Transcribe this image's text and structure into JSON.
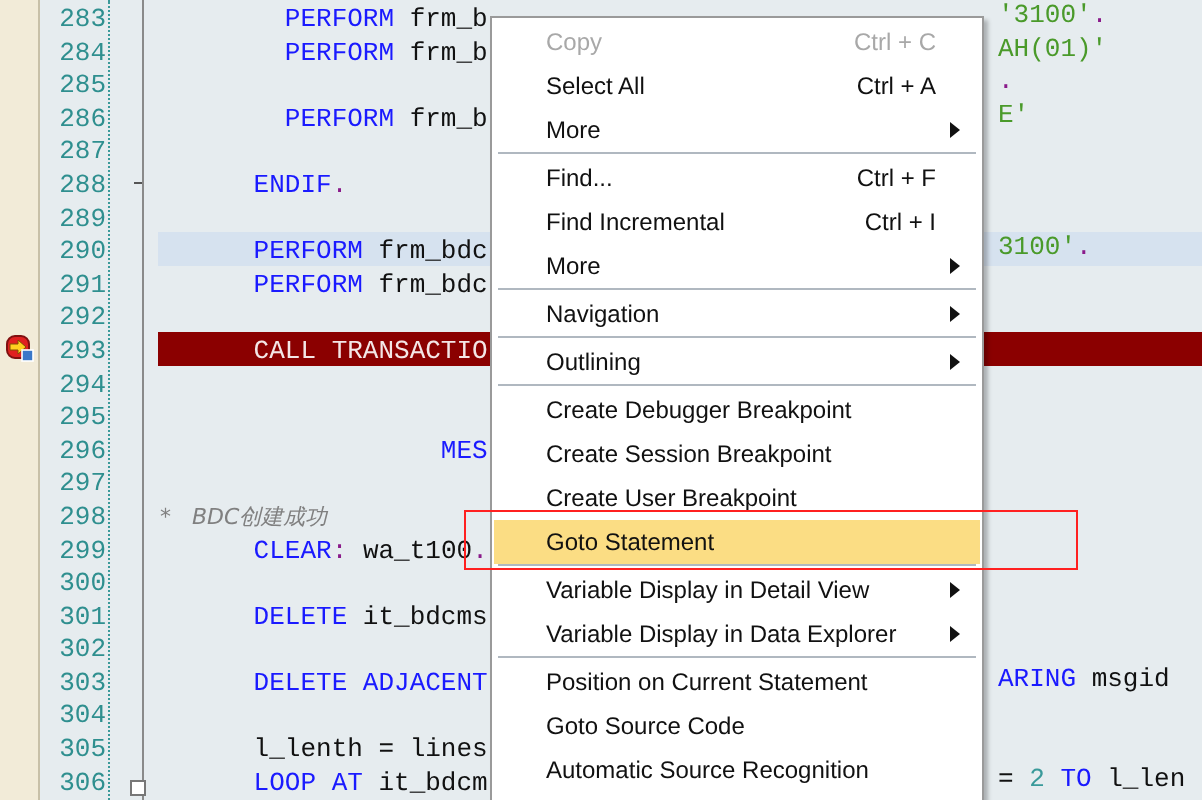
{
  "editor": {
    "lines": [
      {
        "number": "283",
        "kind": "normal",
        "left": [
          {
            "text": "        PERFORM",
            "kind": "keyword"
          },
          {
            "text": " frm_b",
            "kind": "plain"
          }
        ],
        "tail": [
          {
            "text": "'3100'",
            "kind": "string"
          },
          {
            "text": ".",
            "kind": "punct"
          }
        ]
      },
      {
        "number": "284",
        "kind": "normal",
        "left": [
          {
            "text": "        PERFORM",
            "kind": "keyword"
          },
          {
            "text": " frm_b",
            "kind": "plain"
          }
        ],
        "tail": [
          {
            "text": "AH(01)'",
            "kind": "string"
          }
        ]
      },
      {
        "number": "285",
        "kind": "normal",
        "tail": [
          {
            "text": ".",
            "kind": "punct"
          }
        ]
      },
      {
        "number": "286",
        "kind": "normal",
        "left": [
          {
            "text": "        PERFORM",
            "kind": "keyword"
          },
          {
            "text": " frm_b",
            "kind": "plain"
          }
        ],
        "tail": [
          {
            "text": "E'",
            "kind": "string"
          }
        ]
      },
      {
        "number": "287",
        "kind": "normal"
      },
      {
        "number": "288",
        "kind": "normal",
        "fold_end": true,
        "left": [
          {
            "text": "      ENDIF",
            "kind": "keyword"
          },
          {
            "text": ".",
            "kind": "punct"
          }
        ]
      },
      {
        "number": "289",
        "kind": "normal"
      },
      {
        "number": "290",
        "kind": "cursor",
        "left": [
          {
            "text": "      PERFORM",
            "kind": "keyword"
          },
          {
            "text": " frm_bdc",
            "kind": "plain"
          }
        ],
        "tail": [
          {
            "text": "3100'",
            "kind": "string"
          },
          {
            "text": ".",
            "kind": "punct"
          }
        ]
      },
      {
        "number": "291",
        "kind": "normal",
        "left": [
          {
            "text": "      PERFORM",
            "kind": "keyword"
          },
          {
            "text": " frm_bdc",
            "kind": "plain"
          }
        ]
      },
      {
        "number": "292",
        "kind": "normal"
      },
      {
        "number": "293",
        "kind": "current",
        "breakpoint": true,
        "left": [
          {
            "text": "      CALL TRANSACTIO",
            "kind": "plain"
          }
        ]
      },
      {
        "number": "294",
        "kind": "normal"
      },
      {
        "number": "295",
        "kind": "normal"
      },
      {
        "number": "296",
        "kind": "normal",
        "left": [
          {
            "text": "                  MES",
            "kind": "keyword"
          }
        ]
      },
      {
        "number": "297",
        "kind": "normal"
      },
      {
        "number": "298",
        "kind": "normal",
        "left": [
          {
            "text": "*   BDC创建成功",
            "kind": "comment"
          }
        ]
      },
      {
        "number": "299",
        "kind": "normal",
        "left": [
          {
            "text": "      CLEAR",
            "kind": "keyword"
          },
          {
            "text": ":",
            "kind": "punct"
          },
          {
            "text": " wa_t100",
            "kind": "plain"
          },
          {
            "text": ".",
            "kind": "punct"
          }
        ]
      },
      {
        "number": "300",
        "kind": "normal"
      },
      {
        "number": "301",
        "kind": "normal",
        "left": [
          {
            "text": "      DELETE",
            "kind": "keyword"
          },
          {
            "text": " it_bdcms",
            "kind": "plain"
          }
        ]
      },
      {
        "number": "302",
        "kind": "normal"
      },
      {
        "number": "303",
        "kind": "normal",
        "left": [
          {
            "text": "      DELETE ADJACENT",
            "kind": "keyword"
          }
        ],
        "tail": [
          {
            "text": "ARING",
            "kind": "keyword"
          },
          {
            "text": " msgid",
            "kind": "plain"
          }
        ]
      },
      {
        "number": "304",
        "kind": "normal"
      },
      {
        "number": "305",
        "kind": "normal",
        "left": [
          {
            "text": "      l_lenth = lines",
            "kind": "plain"
          }
        ]
      },
      {
        "number": "306",
        "kind": "normal",
        "fold_start": true,
        "left": [
          {
            "text": "      LOOP AT",
            "kind": "keyword"
          },
          {
            "text": " it_bdcm",
            "kind": "plain"
          }
        ],
        "tail": [
          {
            "text": "= ",
            "kind": "plain"
          },
          {
            "text": "2",
            "kind": "number"
          },
          {
            "text": " TO",
            "kind": "keyword"
          },
          {
            "text": " l_len",
            "kind": "plain"
          }
        ]
      }
    ]
  },
  "context_menu": {
    "items": [
      {
        "kind": "item",
        "label": "Copy",
        "shortcut": "Ctrl + C",
        "disabled": true,
        "submenu": false,
        "selected": false,
        "framed": false
      },
      {
        "kind": "item",
        "label": "Select All",
        "shortcut": "Ctrl + A",
        "disabled": false,
        "submenu": false,
        "selected": false,
        "framed": false
      },
      {
        "kind": "item",
        "label": "More",
        "disabled": false,
        "submenu": true,
        "selected": false,
        "framed": false
      },
      {
        "kind": "separator"
      },
      {
        "kind": "item",
        "label": "Find...",
        "shortcut": "Ctrl + F",
        "disabled": false,
        "submenu": false,
        "selected": false,
        "framed": false
      },
      {
        "kind": "item",
        "label": "Find Incremental",
        "shortcut": "Ctrl + I",
        "disabled": false,
        "submenu": false,
        "selected": false,
        "framed": false
      },
      {
        "kind": "item",
        "label": "More",
        "disabled": false,
        "submenu": true,
        "selected": false,
        "framed": false
      },
      {
        "kind": "separator"
      },
      {
        "kind": "item",
        "label": "Navigation",
        "disabled": false,
        "submenu": true,
        "selected": false,
        "framed": false
      },
      {
        "kind": "separator"
      },
      {
        "kind": "item",
        "label": "Outlining",
        "disabled": false,
        "submenu": true,
        "selected": false,
        "framed": false
      },
      {
        "kind": "separator"
      },
      {
        "kind": "item",
        "label": "Create Debugger Breakpoint",
        "disabled": false,
        "submenu": false,
        "selected": false,
        "framed": false
      },
      {
        "kind": "item",
        "label": "Create Session Breakpoint",
        "disabled": false,
        "submenu": false,
        "selected": false,
        "framed": false
      },
      {
        "kind": "item",
        "label": "Create User Breakpoint",
        "disabled": false,
        "submenu": false,
        "selected": false,
        "framed": false
      },
      {
        "kind": "item",
        "label": "Goto Statement",
        "disabled": false,
        "submenu": false,
        "selected": true,
        "framed": true
      },
      {
        "kind": "separator"
      },
      {
        "kind": "item",
        "label": "Variable Display in Detail View",
        "disabled": false,
        "submenu": true,
        "selected": false,
        "framed": false
      },
      {
        "kind": "item",
        "label": "Variable Display in Data Explorer",
        "disabled": false,
        "submenu": true,
        "selected": false,
        "framed": false
      },
      {
        "kind": "separator"
      },
      {
        "kind": "item",
        "label": "Position on Current Statement",
        "disabled": false,
        "submenu": false,
        "selected": false,
        "framed": false
      },
      {
        "kind": "item",
        "label": "Goto Source Code",
        "disabled": false,
        "submenu": false,
        "selected": false,
        "framed": false
      },
      {
        "kind": "item",
        "label": "Automatic Source Recognition",
        "disabled": false,
        "submenu": false,
        "selected": false,
        "framed": false
      }
    ]
  }
}
